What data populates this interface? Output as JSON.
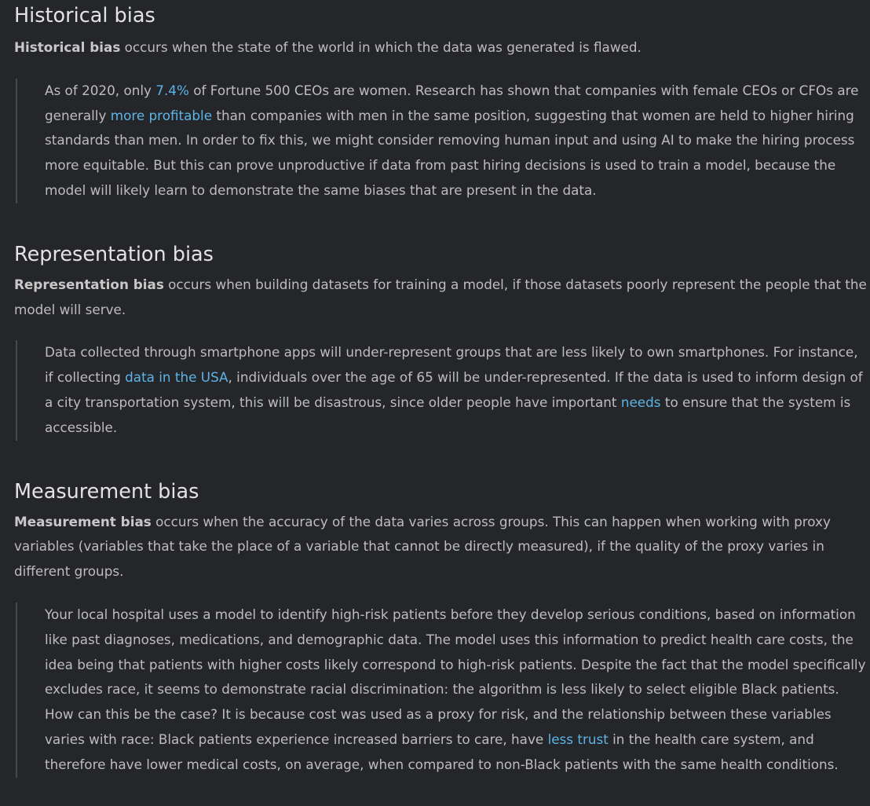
{
  "sections": [
    {
      "title": "Historical bias",
      "def_term": "Historical bias",
      "def_rest": " occurs when the state of the world in which the data was generated is flawed.",
      "quote": {
        "t1": "As of 2020, only ",
        "l1": "7.4%",
        "t2": " of Fortune 500 CEOs are women. Research has shown that companies with female CEOs or CFOs are generally ",
        "l2": "more profitable",
        "t3": " than companies with men in the same position, suggesting that women are held to higher hiring standards than men. In order to fix this, we might consider removing human input and using AI to make the hiring process more equitable. But this can prove unproductive if data from past hiring decisions is used to train a model, because the model will likely learn to demonstrate the same biases that are present in the data."
      }
    },
    {
      "title": "Representation bias",
      "def_term": "Representation bias",
      "def_rest": " occurs when building datasets for training a model, if those datasets poorly represent the people that the model will serve.",
      "quote": {
        "t1": "Data collected through smartphone apps will under-represent groups that are less likely to own smartphones. For instance, if collecting ",
        "l1": "data in the USA",
        "t2": ", individuals over the age of 65 will be under-represented. If the data is used to inform design of a city transportation system, this will be disastrous, since older people have important ",
        "l2": "needs",
        "t3": " to ensure that the system is accessible."
      }
    },
    {
      "title": "Measurement bias",
      "def_term": "Measurement bias",
      "def_rest": " occurs when the accuracy of the data varies across groups. This can happen when working with proxy variables (variables that take the place of a variable that cannot be directly measured), if the quality of the proxy varies in different groups.",
      "quote": {
        "t1": "Your local hospital uses a model to identify high-risk patients before they develop serious conditions, based on information like past diagnoses, medications, and demographic data. The model uses this information to predict health care costs, the idea being that patients with higher costs likely correspond to high-risk patients. Despite the fact that the model specifically excludes race, it seems to demonstrate racial discrimination: the algorithm is less likely to select eligible Black patients. How can this be the case? It is because cost was used as a proxy for risk, and the relationship between these variables varies with race: Black patients experience increased barriers to care, have ",
        "l1": "less trust",
        "t2": " in the health care system, and therefore have lower medical costs, on average, when compared to non-Black patients with the same health conditions."
      }
    }
  ]
}
